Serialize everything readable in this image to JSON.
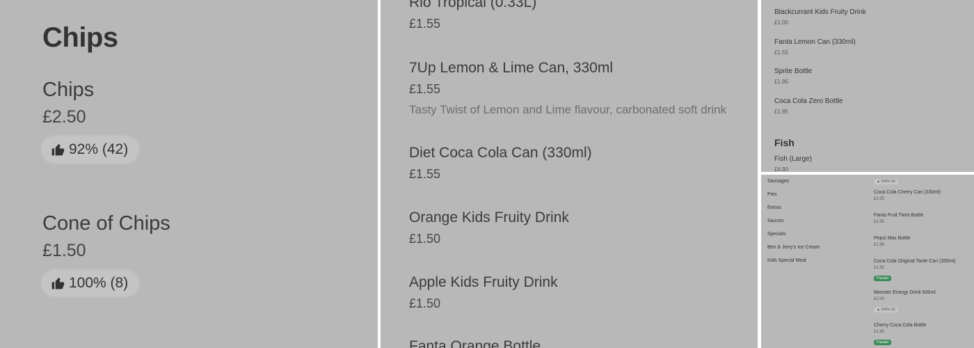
{
  "panel1": {
    "section_title": "Chips",
    "items": [
      {
        "name": "Chips",
        "price": "£2.50",
        "rating": "92% (42)"
      },
      {
        "name": "Cone of Chips",
        "price": "£1.50",
        "rating": "100% (8)"
      }
    ],
    "rating_icon": "thumbs-up-icon"
  },
  "panel2": {
    "items": [
      {
        "name": "Rio Tropical (0.33L)",
        "price": "£1.55"
      },
      {
        "name": "7Up Lemon & Lime Can, 330ml",
        "price": "£1.55",
        "description": "Tasty Twist of Lemon and Lime flavour, carbonated soft drink"
      },
      {
        "name": "Diet Coca Cola Can (330ml)",
        "price": "£1.55"
      },
      {
        "name": "Orange Kids Fruity Drink",
        "price": "£1.50"
      },
      {
        "name": "Apple Kids Fruity Drink",
        "price": "£1.50"
      },
      {
        "name": "Fanta Orange Bottle",
        "price": ""
      }
    ]
  },
  "panel3": {
    "items": [
      {
        "name": "Blackcurrant Kids Fruity Drink",
        "price": "£1.00"
      },
      {
        "name": "Fanta Lemon Can (330ml)",
        "price": "£1.55"
      },
      {
        "name": "Sprite Bottle",
        "price": "£1.95"
      },
      {
        "name": "Coca Cola Zero Bottle",
        "price": "£1.95"
      }
    ],
    "section_title": "Fish",
    "fish_items": [
      {
        "name": "Fish (Large)",
        "price": "£6.90"
      }
    ]
  },
  "panel4": {
    "categories": [
      "Sausages",
      "Pies",
      "Extras",
      "Sauces",
      "Specials",
      "Ben & Jerry's Ice Cream",
      "Kids Special Meal"
    ],
    "top_badge": "100% (4)",
    "items": [
      {
        "name": "Coca Cola Cherry Can (330ml)",
        "price": "£1.55"
      },
      {
        "name": "Fanta Fruit Twist Bottle",
        "price": "£1.55"
      },
      {
        "name": "Pepsi Max Bottle",
        "price": "£1.95"
      },
      {
        "name": "Coca Cola Original Taste Can (330ml)",
        "price": "£1.55",
        "badge": "Popular"
      },
      {
        "name": "Monster Energy Drink 500ml",
        "price": "£2.00",
        "rating": "100% (3)"
      },
      {
        "name": "Cherry Coca Cola Bottle",
        "price": "£1.95",
        "badge": "Popular"
      }
    ]
  },
  "colors": {
    "panel_bg": "#b8b8b8",
    "popular_badge": "#3d8b5a",
    "divider": "#ffffff"
  }
}
